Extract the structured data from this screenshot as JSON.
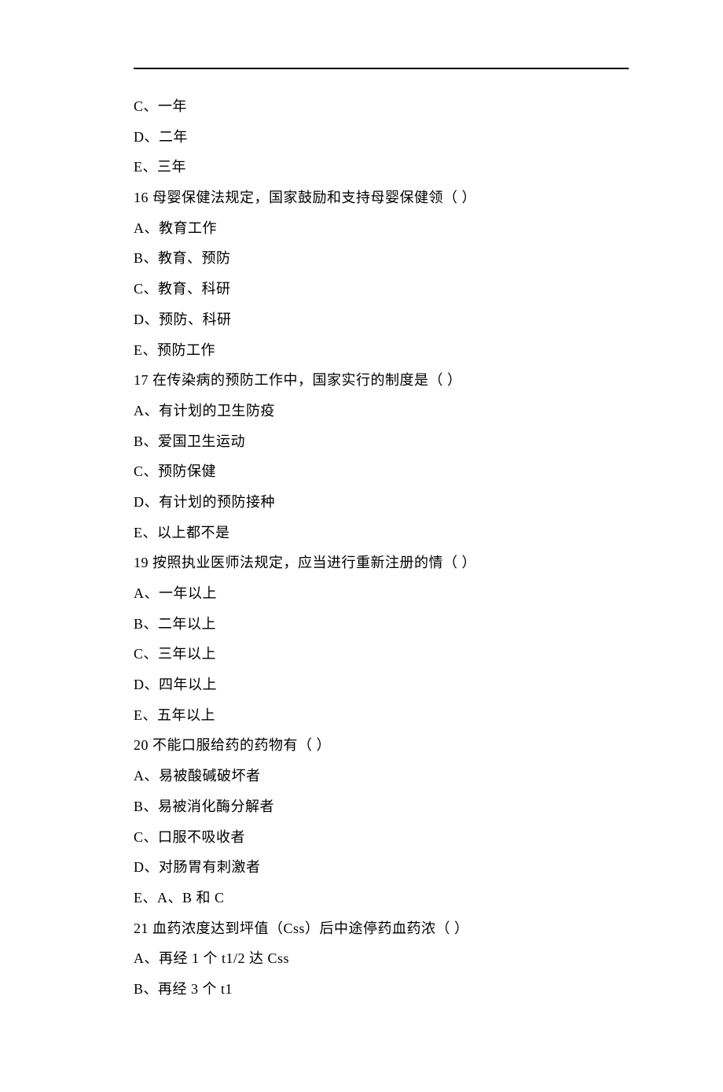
{
  "lines": [
    "C、一年",
    "D、二年",
    "E、三年",
    "16 母婴保健法规定，国家鼓励和支持母婴保健领（   ）",
    "A、教育工作",
    "B、教育、预防",
    "C、教育、科研",
    "D、预防、科研",
    "E、预防工作",
    "17 在传染病的预防工作中，国家实行的制度是（   ）",
    "A、有计划的卫生防疫",
    "B、爱国卫生运动",
    "C、预防保健",
    "D、有计划的预防接种",
    "E、以上都不是",
    "19 按照执业医师法规定，应当进行重新注册的情（   ）",
    "A、一年以上",
    "B、二年以上",
    "C、三年以上",
    "D、四年以上",
    "E、五年以上",
    "20 不能口服给药的药物有（   ）",
    "A、易被酸碱破坏者",
    "B、易被消化酶分解者",
    "C、口服不吸收者",
    "D、对肠胃有刺激者",
    "E、A、B 和 C",
    "21 血药浓度达到坪值（Css）后中途停药血药浓（   ）",
    "A、再经 1 个 t1/2 达 Css",
    "B、再经 3 个 t1"
  ]
}
